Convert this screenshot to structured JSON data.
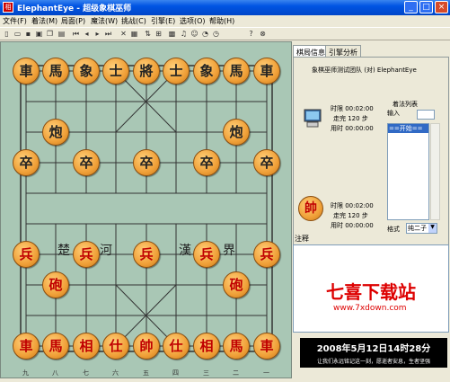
{
  "window": {
    "title": "ElephantEye - 超级象棋巫师",
    "app_icon_text": "相"
  },
  "menu": [
    "文件(F)",
    "着法(M)",
    "局面(P)",
    "魔法(W)",
    "挑战(C)",
    "引擎(E)",
    "选项(O)",
    "帮助(H)"
  ],
  "toolbar_icons": [
    "new-icon",
    "open-icon",
    "save-icon",
    "save-as-icon",
    "copy-icon",
    "paste-icon",
    "first-move-icon",
    "prev-move-icon",
    "next-move-icon",
    "last-move-icon",
    "delete-icon",
    "flip-board-icon",
    "swap-sides-icon",
    "piece-style-icon",
    "board-style-icon",
    "music-icon",
    "emotion-icon",
    "think-icon",
    "time-icon",
    "help-icon",
    "stop-icon"
  ],
  "board": {
    "black_pieces": [
      "車",
      "馬",
      "象",
      "士",
      "將",
      "士",
      "象",
      "馬",
      "車",
      "炮",
      "炮",
      "卒",
      "卒",
      "卒",
      "卒",
      "卒"
    ],
    "red_pieces": [
      "兵",
      "兵",
      "兵",
      "兵",
      "兵",
      "砲",
      "砲",
      "車",
      "馬",
      "相",
      "仕",
      "帥",
      "仕",
      "相",
      "馬",
      "車"
    ],
    "river_chars": [
      "楚",
      "河",
      "漢",
      "界"
    ],
    "file_labels": [
      "九",
      "八",
      "七",
      "六",
      "五",
      "四",
      "三",
      "二",
      "一"
    ]
  },
  "tabs": [
    "棋局信息",
    "引擎分析"
  ],
  "info": {
    "opponent_line": "象棋巫师测试团队 (对) ElephantEye",
    "top": {
      "limit": "时限  00:02:00",
      "moves": "走完  120 步",
      "used": "用时  00:00:00"
    },
    "bottom": {
      "limit": "时限  00:02:00",
      "moves": "走完  120 步",
      "used": "用时  00:00:00"
    },
    "movelist_title": "着法列表",
    "input_label": "输入",
    "movelist_selected": "==开始==",
    "format_label": "格式",
    "format_value": "纯二子"
  },
  "note_label": "注释",
  "watermark": {
    "brand": "七喜下载站",
    "url": "www.7xdown.com"
  },
  "clock": {
    "datetime": "2008年5月12日14时28分",
    "caption": "让我们永远铭记这一刻，愿逝者安息，生者坚强"
  }
}
